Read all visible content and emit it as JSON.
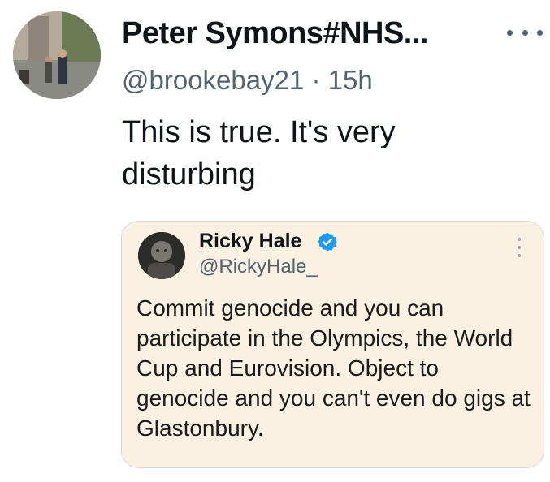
{
  "tweet": {
    "author_name": "Peter Symons#NHS...",
    "handle": "@brookebay21",
    "separator": "·",
    "time": "15h",
    "text": "This is true. It's very disturbing",
    "more_icon": "more-horizontal-icon"
  },
  "quote": {
    "author_name": "Ricky Hale",
    "verified_icon": "verified-badge-icon",
    "verified_color": "#1d9bf0",
    "handle": "@RickyHale_",
    "text": "Commit genocide and you can participate in the Olympics, the World Cup and Eurovision. Object to genocide and you can't even do gigs at Glastonbury.",
    "background": "#fbf1e2"
  }
}
